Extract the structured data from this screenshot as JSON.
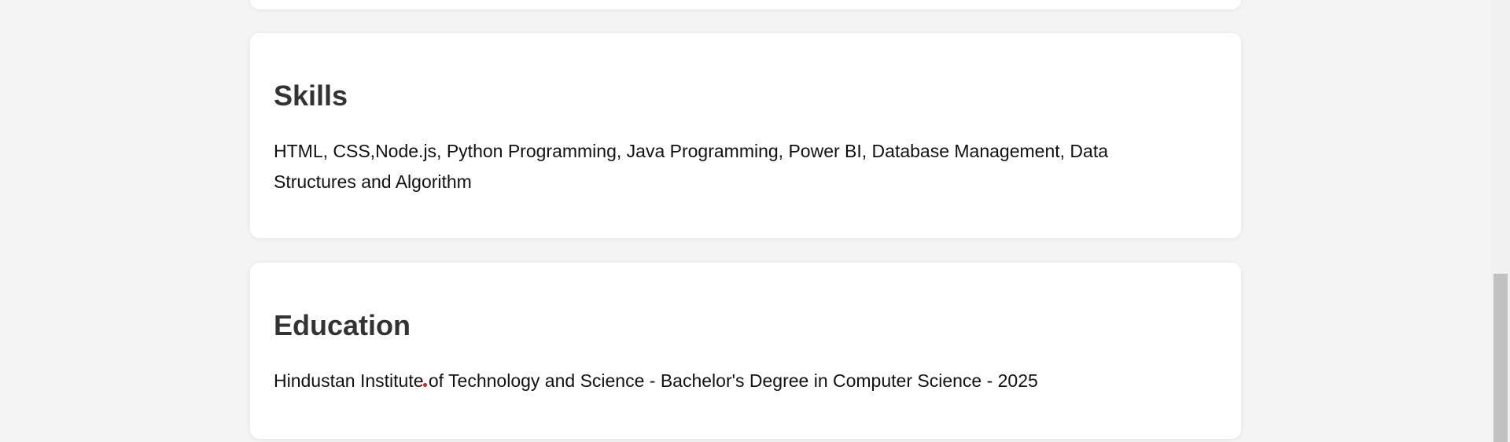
{
  "cards": {
    "skills": {
      "title": "Skills",
      "text": "HTML, CSS,Node.js, Python Programming, Java Programming, Power BI, Database Management, Data Structures and Algorithm"
    },
    "education": {
      "title": "Education",
      "text": "Hindustan Institute of Technology and Science - Bachelor's Degree in Computer Science - 2025"
    }
  },
  "colors": {
    "page_background": "#f4f4f4",
    "card_background": "#ffffff",
    "heading": "#333333",
    "body_text": "#111111",
    "cursor": "#e0201b",
    "scrollbar_thumb": "#c1c1c1"
  }
}
